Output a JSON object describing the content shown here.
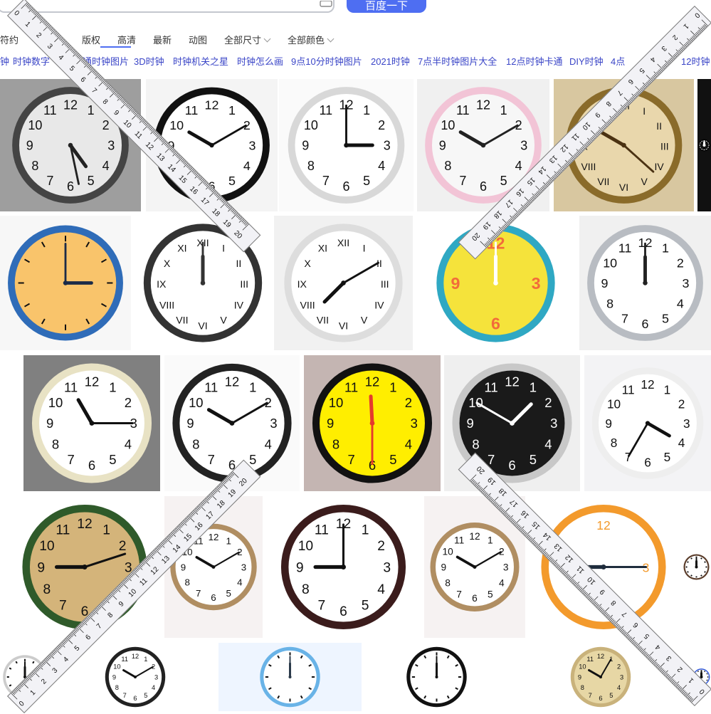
{
  "search": {
    "button_label": "百度一下",
    "camera_icon": "camera-icon"
  },
  "filters": {
    "truncated_first": "符约",
    "copyright": "版权",
    "hd": "高清",
    "latest": "最新",
    "animated": "动图",
    "all_sizes": "全部尺寸",
    "all_colors": "全部颜色"
  },
  "tags": [
    "钟",
    "时钟数字",
    "卡通时钟图片",
    "3D时钟",
    "时钟机关之星",
    "时钟怎么画",
    "9点10分时钟图片",
    "2021时钟",
    "7点半时钟图片大全",
    "12点时钟卡通",
    "DIY时钟",
    "4点",
    "12时钟"
  ],
  "colors": {
    "accent": "#4e6ef2",
    "tag_link": "#3a45c7"
  },
  "rulers": [
    {
      "label": "ruler-top-left",
      "ticks": [
        "0",
        "1",
        "2",
        "3",
        "4",
        "5",
        "6",
        "7",
        "8",
        "9",
        "10",
        "11",
        "12",
        "13",
        "14",
        "15",
        "16",
        "17",
        "18",
        "19",
        "20"
      ]
    },
    {
      "label": "ruler-top-right",
      "ticks": [
        "0",
        "1",
        "2",
        "3",
        "4",
        "5",
        "6",
        "7",
        "8",
        "9",
        "10",
        "11",
        "12",
        "13",
        "14",
        "15",
        "16",
        "17",
        "18",
        "19",
        "20"
      ]
    },
    {
      "label": "ruler-bottom-left",
      "ticks": [
        "0",
        "1",
        "2",
        "3",
        "4",
        "5",
        "6",
        "7",
        "8",
        "9",
        "10",
        "11",
        "12",
        "13",
        "14",
        "15",
        "16",
        "17",
        "18",
        "19",
        "20"
      ]
    },
    {
      "label": "ruler-bottom-right",
      "ticks": [
        "0",
        "1",
        "2",
        "3",
        "4",
        "5",
        "6",
        "7",
        "8",
        "9",
        "10",
        "11",
        "12",
        "13",
        "14",
        "15",
        "16",
        "17",
        "18",
        "19",
        "20"
      ]
    }
  ],
  "images": [
    {
      "name": "clock-vintage-gray",
      "bg": "#9e9e9e",
      "face": "#e8e8e8",
      "rim": "#444",
      "hands": "#222",
      "nums": "arabic",
      "h": 4.8,
      "m": 28
    },
    {
      "name": "clock-black-rim",
      "bg": "#f4f4f4",
      "face": "#ffffff",
      "rim": "#111",
      "hands": "#111",
      "nums": "arabic",
      "h": 10,
      "m": 10
    },
    {
      "name": "clock-white-3oclock",
      "bg": "#fafafa",
      "face": "#ffffff",
      "rim": "#d8d8d8",
      "hands": "#111",
      "nums": "arabic",
      "h": 3,
      "m": 0
    },
    {
      "name": "clock-pink-rim",
      "bg": "#f0f0f0",
      "face": "#f7f7f7",
      "rim": "#f2c4d6",
      "hands": "#222",
      "nums": "arabic",
      "h": 10,
      "m": 10
    },
    {
      "name": "clock-gold-roman",
      "bg": "#d8c7a0",
      "face": "#e9d7ac",
      "rim": "#8a6b2a",
      "hands": "#4b3212",
      "nums": "roman",
      "h": 10,
      "m": 22
    },
    {
      "name": "clock-partial-black",
      "bg": "#111",
      "face": "#111",
      "rim": "#000",
      "hands": "#fff",
      "nums": "none",
      "h": 0,
      "m": 0
    },
    {
      "name": "clock-blue-orange-icon",
      "bg": "#f7f7f7",
      "face": "#f9c46b",
      "rim": "#2f6cb8",
      "hands": "#1b2b48",
      "nums": "none",
      "h": 3,
      "m": 0
    },
    {
      "name": "clock-roman-outline",
      "bg": "#ffffff",
      "face": "#ffffff",
      "rim": "#333",
      "hands": "#333",
      "nums": "roman",
      "h": 0,
      "m": 0
    },
    {
      "name": "clock-white-roman-black",
      "bg": "#f1f1f1",
      "face": "#ffffff",
      "rim": "#ddd",
      "hands": "#111",
      "nums": "roman",
      "h": 7.5,
      "m": 10
    },
    {
      "name": "clock-cartoon-bear",
      "bg": "#ffffff",
      "face": "#f5e33b",
      "rim": "#2fa8c3",
      "hands": "#fff",
      "nums": "cartoon",
      "h": 0,
      "m": 0
    },
    {
      "name": "clock-silver-rim",
      "bg": "#f0f0f0",
      "face": "#ffffff",
      "rim": "#b8bcc2",
      "hands": "#222",
      "nums": "arabic",
      "h": 0,
      "m": 0
    },
    {
      "name": "clock-alarm-cream",
      "bg": "#808080",
      "face": "#fff",
      "rim": "#e8e2c4",
      "hands": "#111",
      "nums": "arabic",
      "h": 11,
      "m": 15
    },
    {
      "name": "clock-gradient-rim",
      "bg": "#fafafa",
      "face": "#ffffff",
      "rim": "#222",
      "hands": "#111",
      "nums": "arabic",
      "h": 10,
      "m": 10
    },
    {
      "name": "clock-yellow-red-hands",
      "bg": "#c4b5b2",
      "face": "#ffee00",
      "rim": "#111",
      "hands": "#e53a2d",
      "nums": "arabic",
      "h": 11.9,
      "m": 30
    },
    {
      "name": "clock-black-face",
      "bg": "#efefef",
      "face": "#1a1a1a",
      "rim": "#c8c8c8",
      "hands": "#fff",
      "nums": "arabic-white",
      "h": 1.5,
      "m": 50
    },
    {
      "name": "clock-white-minimal",
      "bg": "#f3f3f5",
      "face": "#ffffff",
      "rim": "#eee",
      "hands": "#111",
      "nums": "arabic",
      "h": 4,
      "m": 35
    },
    {
      "name": "clock-green-rim-vintage",
      "bg": "#ffffff",
      "face": "#d4b47a",
      "rim": "#2f5a2a",
      "hands": "#111",
      "nums": "arabic",
      "h": 9,
      "m": 12
    },
    {
      "name": "clock-pendulum-ornate",
      "bg": "#f6f2f2",
      "face": "#ffffff",
      "rim": "#b08e62",
      "hands": "#111",
      "nums": "arabic",
      "h": 10,
      "m": 10
    },
    {
      "name": "clock-dark-red-rim",
      "bg": "#ffffff",
      "face": "#ffffff",
      "rim": "#3b1c1c",
      "hands": "#111",
      "nums": "arabic",
      "h": 9,
      "m": 0
    },
    {
      "name": "clock-pendulum-ornate-2",
      "bg": "#f6f2f2",
      "face": "#ffffff",
      "rim": "#b08e62",
      "hands": "#111",
      "nums": "arabic",
      "h": 10,
      "m": 10
    },
    {
      "name": "clock-orange-rim",
      "bg": "#ffffff",
      "face": "#ffffff",
      "rim": "#f39a2c",
      "hands": "#1f2d3d",
      "nums": "partial",
      "h": 9,
      "m": 15
    },
    {
      "name": "clock-brown-row",
      "bg": "#ffffff",
      "face": "#ffffff",
      "rim": "#5a3c2a",
      "hands": "#111",
      "nums": "none",
      "h": 0,
      "m": 0
    },
    {
      "name": "clock-small-partial",
      "bg": "#ffffff",
      "face": "#ffffff",
      "rim": "#ccc",
      "hands": "#111",
      "nums": "none",
      "h": 0,
      "m": 0
    },
    {
      "name": "clock-black-thin",
      "bg": "#ffffff",
      "face": "#ffffff",
      "rim": "#222",
      "hands": "#111",
      "nums": "arabic",
      "h": 10,
      "m": 10
    },
    {
      "name": "clock-light-blue",
      "bg": "#eef5ff",
      "face": "#ffffff",
      "rim": "#69b3e7",
      "hands": "#2b3a4a",
      "nums": "none",
      "h": 0,
      "m": 0
    },
    {
      "name": "clock-black-minimal",
      "bg": "#ffffff",
      "face": "#ffffff",
      "rim": "#111",
      "hands": "#111",
      "nums": "none",
      "h": 0,
      "m": 0
    },
    {
      "name": "clock-beige",
      "bg": "#ffffff",
      "face": "#e7d7a5",
      "rim": "#c9b27b",
      "hands": "#111",
      "nums": "arabic",
      "h": 10,
      "m": 5
    },
    {
      "name": "clock-blue-partial",
      "bg": "#ffffff",
      "face": "#ffffff",
      "rim": "#2b53d6",
      "hands": "#111",
      "nums": "none",
      "h": 0,
      "m": 0
    }
  ]
}
